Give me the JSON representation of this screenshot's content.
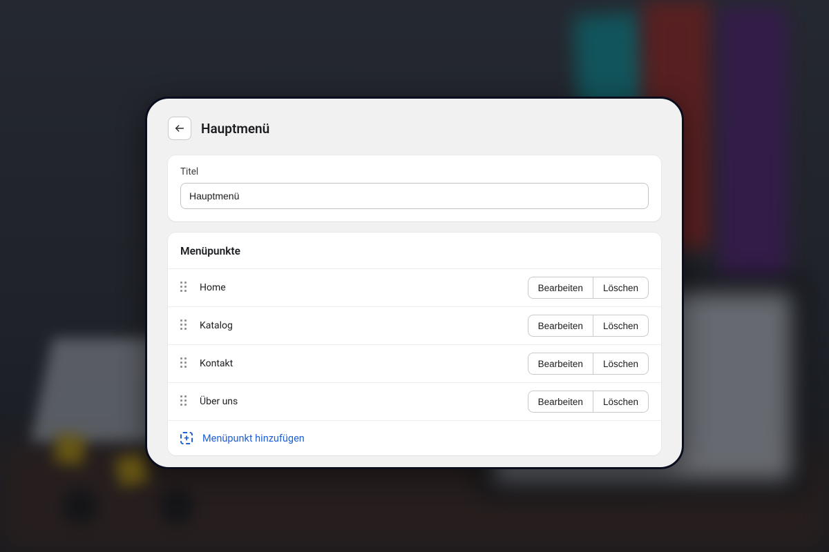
{
  "header": {
    "page_title": "Hauptmenü"
  },
  "title_field": {
    "label": "Titel",
    "value": "Hauptmenü"
  },
  "menu_section": {
    "heading": "Menüpunkte",
    "edit_label": "Bearbeiten",
    "delete_label": "Löschen",
    "add_label": "Menüpunkt hinzufügen",
    "items": [
      {
        "label": "Home"
      },
      {
        "label": "Katalog"
      },
      {
        "label": "Kontakt"
      },
      {
        "label": "Über uns"
      }
    ]
  }
}
